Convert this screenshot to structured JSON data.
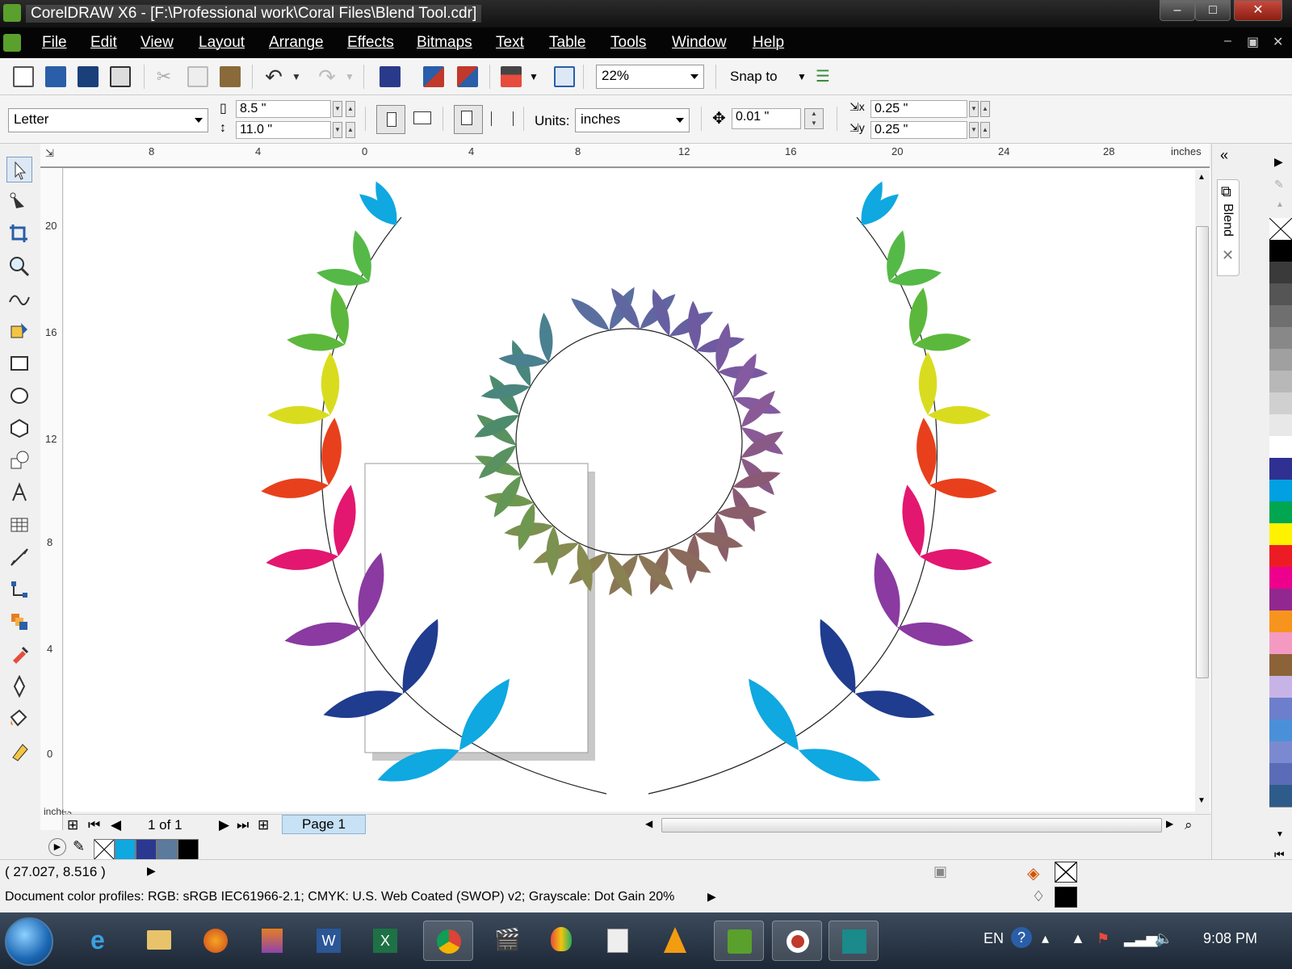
{
  "window": {
    "title": "CorelDRAW X6 - [F:\\Professional work\\Coral Files\\Blend Tool.cdr]",
    "minimize": "–",
    "maximize": "□",
    "close": "✕"
  },
  "menu": {
    "items": [
      "File",
      "Edit",
      "View",
      "Layout",
      "Arrange",
      "Effects",
      "Bitmaps",
      "Text",
      "Table",
      "Tools",
      "Window",
      "Help"
    ],
    "doc_controls": [
      "–",
      "▣",
      "✕"
    ]
  },
  "toolbar": {
    "zoom": "22%",
    "snap_to": "Snap to"
  },
  "property_bar": {
    "paper": "Letter",
    "width": "8.5 \"",
    "height": "11.0 \"",
    "units_label": "Units:",
    "units": "inches",
    "nudge": "0.01 \"",
    "dup_x": "0.25 \"",
    "dup_y": "0.25 \""
  },
  "rulers": {
    "unit": "inches",
    "h_ticks": [
      "8",
      "4",
      "0",
      "4",
      "8",
      "12",
      "16",
      "20",
      "24",
      "28"
    ],
    "v_ticks": [
      "20",
      "16",
      "12",
      "8",
      "4",
      "0"
    ]
  },
  "page_nav": {
    "counter": "1 of 1",
    "tab": "Page 1"
  },
  "dock": {
    "blend_label": "Blend"
  },
  "status": {
    "coords": "( 27.027, 8.516 )",
    "color_profiles": "Document color profiles: RGB: sRGB IEC61966-2.1; CMYK: U.S. Web Coated (SWOP) v2; Grayscale: Dot Gain 20%"
  },
  "taskbar": {
    "language": "EN",
    "time": "9:08 PM"
  },
  "document_palette": [
    "#0fa8e0",
    "#2b3890",
    "#5b7a9c",
    "#000000"
  ],
  "color_palette": [
    "none",
    "#000000",
    "#3a3a3a",
    "#555555",
    "#6f6f6f",
    "#888888",
    "#a0a0a0",
    "#b8b8b8",
    "#d0d0d0",
    "#e8e8e8",
    "#ffffff",
    "#2e3192",
    "#00a0e3",
    "#00a650",
    "#fff200",
    "#ed1c24",
    "#ec008c",
    "#92278f",
    "#f7941d",
    "#f49ac2",
    "#8c6239",
    "#c7b3e5",
    "#6d7fcc",
    "#4a90d9",
    "#7b8ad0",
    "#5a6cb8",
    "#2e5c8a"
  ],
  "colors": {
    "wreath_leaves": [
      "#0fa8e0",
      "#55b947",
      "#5cb83c",
      "#d9dc1e",
      "#e8401c",
      "#e3176f",
      "#8a3aa0",
      "#1f3c8f",
      "#0fa8e0"
    ],
    "spiral_start": "#4a6fa0",
    "spiral_end": "#8a5a5a"
  }
}
